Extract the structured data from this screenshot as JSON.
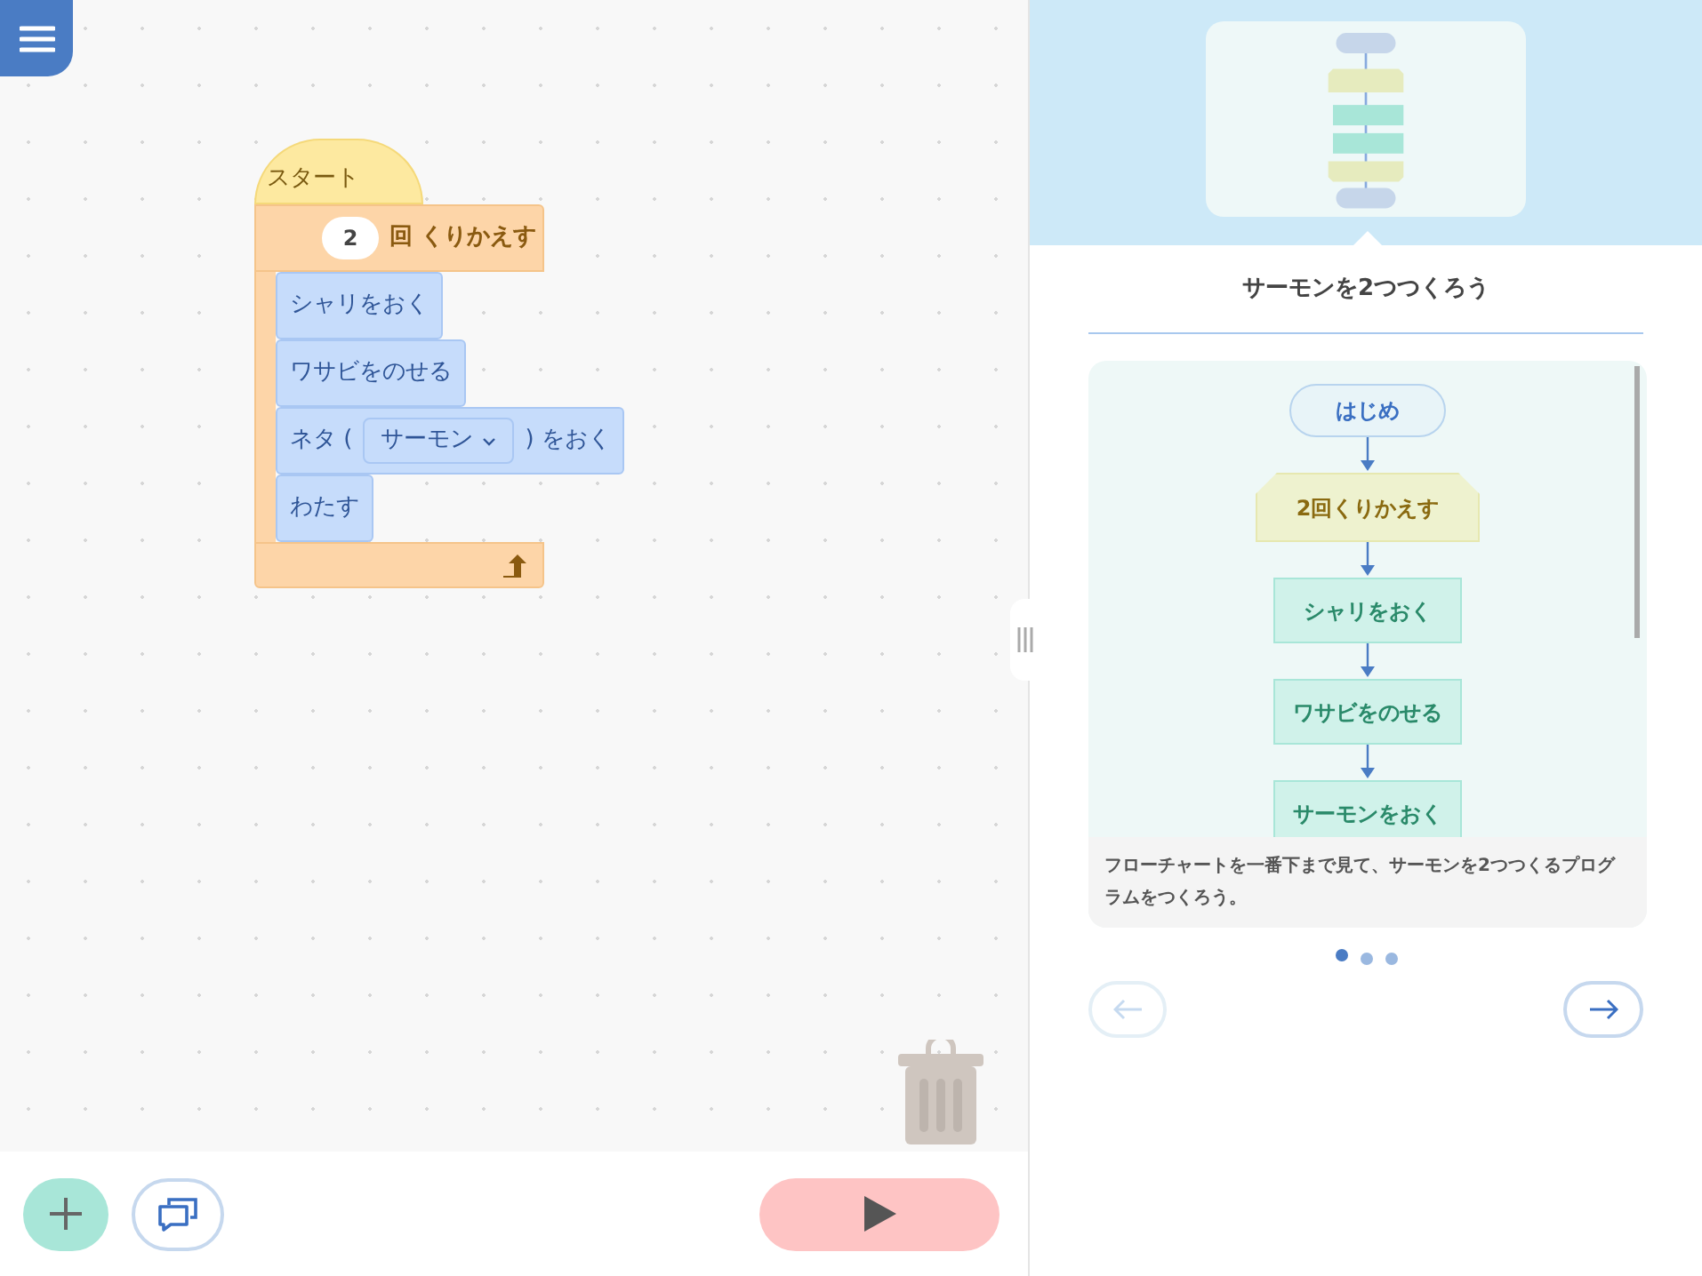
{
  "program": {
    "hat": "スタート",
    "loop": {
      "count": "2",
      "label": "回 くりかえす",
      "body": [
        {
          "kind": "text",
          "text": "シャリをおく"
        },
        {
          "kind": "text",
          "text": "ワサビをのせる"
        },
        {
          "kind": "dropdown",
          "before": "ネタ (",
          "value": "サーモン",
          "after": ") をおく"
        },
        {
          "kind": "text",
          "text": "わたす"
        }
      ]
    }
  },
  "panel": {
    "title": "サーモンを2つつくろう",
    "flowchart": [
      {
        "kind": "terminal",
        "text": "はじめ"
      },
      {
        "kind": "loop",
        "text": "2回くりかえす"
      },
      {
        "kind": "step",
        "text": "シャリをおく"
      },
      {
        "kind": "step",
        "text": "ワサビをのせる"
      },
      {
        "kind": "step",
        "text": "サーモンをおく"
      }
    ],
    "description": "フローチャートを一番下まで見て、サーモンを2つつくるプログラムをつくろう。",
    "pages": [
      {
        "selected": true
      },
      {
        "selected": false
      },
      {
        "selected": false
      }
    ],
    "prev": {
      "disabled": true
    },
    "next": {
      "disabled": false
    }
  }
}
